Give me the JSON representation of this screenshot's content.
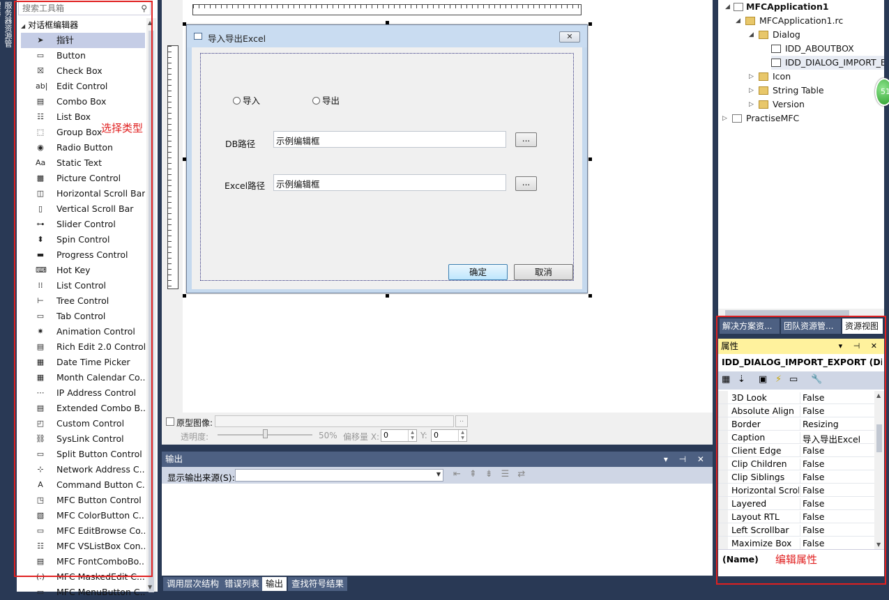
{
  "left_strip": {
    "label": "服务器资源管理器"
  },
  "toolbox": {
    "search_placeholder": "搜索工具箱",
    "group_label": "对话框编辑器",
    "items": [
      {
        "label": "指针",
        "icon": "pointer-icon",
        "glyph": "➤"
      },
      {
        "label": "Button",
        "icon": "button-icon",
        "glyph": "▭"
      },
      {
        "label": "Check Box",
        "icon": "checkbox-icon",
        "glyph": "☒"
      },
      {
        "label": "Edit Control",
        "icon": "edit-control-icon",
        "glyph": "ab|"
      },
      {
        "label": "Combo Box",
        "icon": "combo-box-icon",
        "glyph": "▤"
      },
      {
        "label": "List Box",
        "icon": "list-box-icon",
        "glyph": "☷"
      },
      {
        "label": "Group Box",
        "icon": "group-box-icon",
        "glyph": "⬚"
      },
      {
        "label": "Radio Button",
        "icon": "radio-button-icon",
        "glyph": "◉"
      },
      {
        "label": "Static Text",
        "icon": "static-text-icon",
        "glyph": "Aa"
      },
      {
        "label": "Picture Control",
        "icon": "picture-control-icon",
        "glyph": "▩"
      },
      {
        "label": "Horizontal Scroll Bar",
        "icon": "hscroll-icon",
        "glyph": "◫"
      },
      {
        "label": "Vertical Scroll Bar",
        "icon": "vscroll-icon",
        "glyph": "▯"
      },
      {
        "label": "Slider Control",
        "icon": "slider-icon",
        "glyph": "⊶"
      },
      {
        "label": "Spin Control",
        "icon": "spin-icon",
        "glyph": "⬍"
      },
      {
        "label": "Progress Control",
        "icon": "progress-icon",
        "glyph": "▬"
      },
      {
        "label": "Hot Key",
        "icon": "hotkey-icon",
        "glyph": "⌨"
      },
      {
        "label": "List Control",
        "icon": "list-control-icon",
        "glyph": "⁞⁞"
      },
      {
        "label": "Tree Control",
        "icon": "tree-control-icon",
        "glyph": "⊢"
      },
      {
        "label": "Tab Control",
        "icon": "tab-control-icon",
        "glyph": "▭"
      },
      {
        "label": "Animation Control",
        "icon": "animation-icon",
        "glyph": "✷"
      },
      {
        "label": "Rich Edit 2.0 Control",
        "icon": "rich-edit-icon",
        "glyph": "▤"
      },
      {
        "label": "Date Time Picker",
        "icon": "date-time-icon",
        "glyph": "▦"
      },
      {
        "label": "Month Calendar Co...",
        "icon": "calendar-icon",
        "glyph": "▦"
      },
      {
        "label": "IP Address Control",
        "icon": "ip-address-icon",
        "glyph": "⋯"
      },
      {
        "label": "Extended Combo B...",
        "icon": "ext-combo-icon",
        "glyph": "▤"
      },
      {
        "label": "Custom Control",
        "icon": "custom-control-icon",
        "glyph": "◰"
      },
      {
        "label": "SysLink Control",
        "icon": "syslink-icon",
        "glyph": "⛓"
      },
      {
        "label": "Split Button Control",
        "icon": "split-button-icon",
        "glyph": "▭"
      },
      {
        "label": "Network Address C...",
        "icon": "network-address-icon",
        "glyph": "⊹"
      },
      {
        "label": "Command Button C...",
        "icon": "command-button-icon",
        "glyph": "A"
      },
      {
        "label": "MFC Button Control",
        "icon": "mfc-button-icon",
        "glyph": "◳"
      },
      {
        "label": "MFC ColorButton C...",
        "icon": "mfc-color-icon",
        "glyph": "▧"
      },
      {
        "label": "MFC EditBrowse Co...",
        "icon": "mfc-editbrowse-icon",
        "glyph": "▭"
      },
      {
        "label": "MFC VSListBox Con...",
        "icon": "mfc-vslist-icon",
        "glyph": "☷"
      },
      {
        "label": "MFC FontComboBo...",
        "icon": "mfc-fontcombo-icon",
        "glyph": "▤"
      },
      {
        "label": "MFC MaskedEdit C...",
        "icon": "mfc-masked-icon",
        "glyph": "(.)"
      },
      {
        "label": "MFC MenuButton C...",
        "icon": "mfc-menubutton-icon",
        "glyph": "▭"
      }
    ]
  },
  "annotations": {
    "toolbox_note": "选择类型",
    "props_note": "编辑属性"
  },
  "dialog": {
    "title": "导入导出Excel",
    "close_glyph": "✕",
    "radio_import": "导入",
    "radio_export": "导出",
    "db_label": "DB路径",
    "db_value": "示例编辑框",
    "excel_label": "Excel路径",
    "excel_value": "示例编辑框",
    "browse_label": "...",
    "ok_label": "确定",
    "cancel_label": "取消"
  },
  "prototype_bar": {
    "checkbox_label": "原型图像:",
    "browse_label": "..",
    "opacity_label": "透明度:",
    "opacity_value": "50%",
    "offset_label": "偏移量 X:",
    "x_value": "0",
    "y_label": "Y:",
    "y_value": "0"
  },
  "output": {
    "title": "输出",
    "source_label": "显示输出来源(S):",
    "controls": "▾ ⊣ ✕"
  },
  "bottom_tabs": [
    "调用层次结构",
    "错误列表",
    "输出",
    "查找符号结果"
  ],
  "resource_tree": {
    "project": "MFCApplication1",
    "rc_file": "MFCApplication1.rc",
    "dialog_folder": "Dialog",
    "about_box": "IDD_ABOUTBOX",
    "import_dialog": "IDD_DIALOG_IMPORT_EXPORT",
    "icon_folder": "Icon",
    "string_table": "String Table",
    "version": "Version",
    "other_project": "PractiseMFC"
  },
  "green_badge": "51",
  "view_tabs": [
    "解决方案资...",
    "团队资源管...",
    "资源视图"
  ],
  "properties": {
    "title": "属性",
    "controls": "▾ ⊣ ✕",
    "object": "IDD_DIALOG_IMPORT_EXPORT (Dia",
    "rows": [
      {
        "k": "3D Look",
        "v": "False"
      },
      {
        "k": "Absolute Align",
        "v": "False"
      },
      {
        "k": "Border",
        "v": "Resizing"
      },
      {
        "k": "Caption",
        "v": "导入导出Excel"
      },
      {
        "k": "Client Edge",
        "v": "False"
      },
      {
        "k": "Clip Children",
        "v": "False"
      },
      {
        "k": "Clip Siblings",
        "v": "False"
      },
      {
        "k": "Horizontal Scrol",
        "v": "False"
      },
      {
        "k": "Layered",
        "v": "False"
      },
      {
        "k": "Layout RTL",
        "v": "False"
      },
      {
        "k": "Left Scrollbar",
        "v": "False"
      },
      {
        "k": "Maximize Box",
        "v": "False"
      }
    ],
    "desc_name": "(Name)"
  }
}
